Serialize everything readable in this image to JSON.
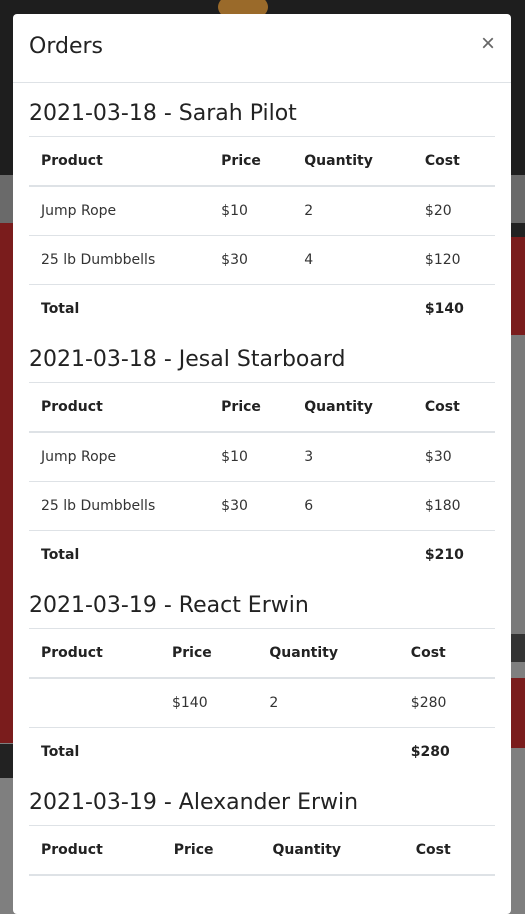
{
  "modal": {
    "title": "Orders",
    "close_label": "×"
  },
  "table_headers": [
    "Product",
    "Price",
    "Quantity",
    "Cost"
  ],
  "total_label": "Total",
  "orders": [
    {
      "title": "2021-03-18 - Sarah Pilot",
      "rows": [
        {
          "product": "Jump Rope",
          "price": "$10",
          "quantity": "2",
          "cost": "$20"
        },
        {
          "product": "25 lb Dumbbells",
          "price": "$30",
          "quantity": "4",
          "cost": "$120"
        }
      ],
      "total": "$140"
    },
    {
      "title": "2021-03-18 - Jesal Starboard",
      "rows": [
        {
          "product": "Jump Rope",
          "price": "$10",
          "quantity": "3",
          "cost": "$30"
        },
        {
          "product": "25 lb Dumbbells",
          "price": "$30",
          "quantity": "6",
          "cost": "$180"
        }
      ],
      "total": "$210"
    },
    {
      "title": "2021-03-19 - React Erwin",
      "rows": [
        {
          "product": "",
          "price": "$140",
          "quantity": "2",
          "cost": "$280"
        }
      ],
      "total": "$280"
    },
    {
      "title": "2021-03-19 - Alexander Erwin",
      "rows": [],
      "total": ""
    }
  ]
}
